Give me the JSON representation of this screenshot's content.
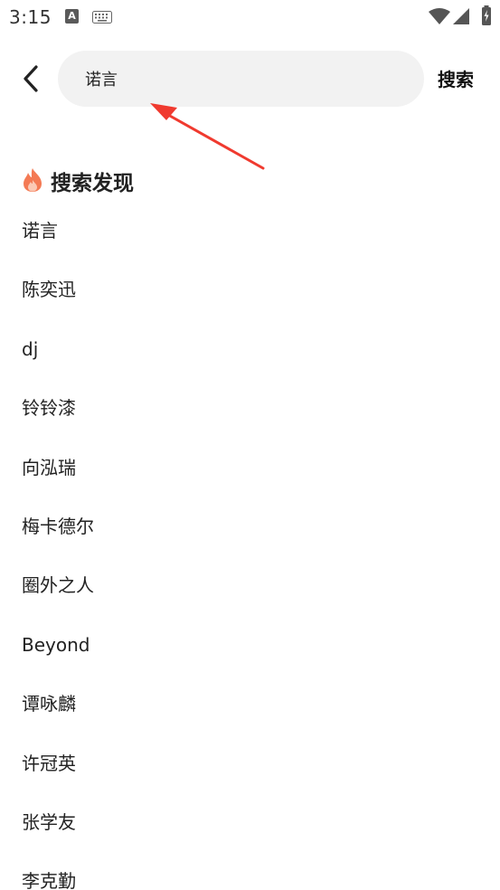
{
  "status_bar": {
    "time": "3:15",
    "a_badge": "A"
  },
  "search": {
    "value": "诺言",
    "button_label": "搜索"
  },
  "discover": {
    "title": "搜索发现",
    "items": [
      "诺言",
      "陈奕迅",
      "dj",
      "铃铃漆",
      "向泓瑞",
      "梅卡德尔",
      "圈外之人",
      "Beyond",
      "谭咏麟",
      "许冠英",
      "张学友",
      "李克勤"
    ]
  },
  "colors": {
    "accent_red": "#f03a2f",
    "fire_orange": "#f47a54",
    "search_bg": "#f2f2f2"
  }
}
